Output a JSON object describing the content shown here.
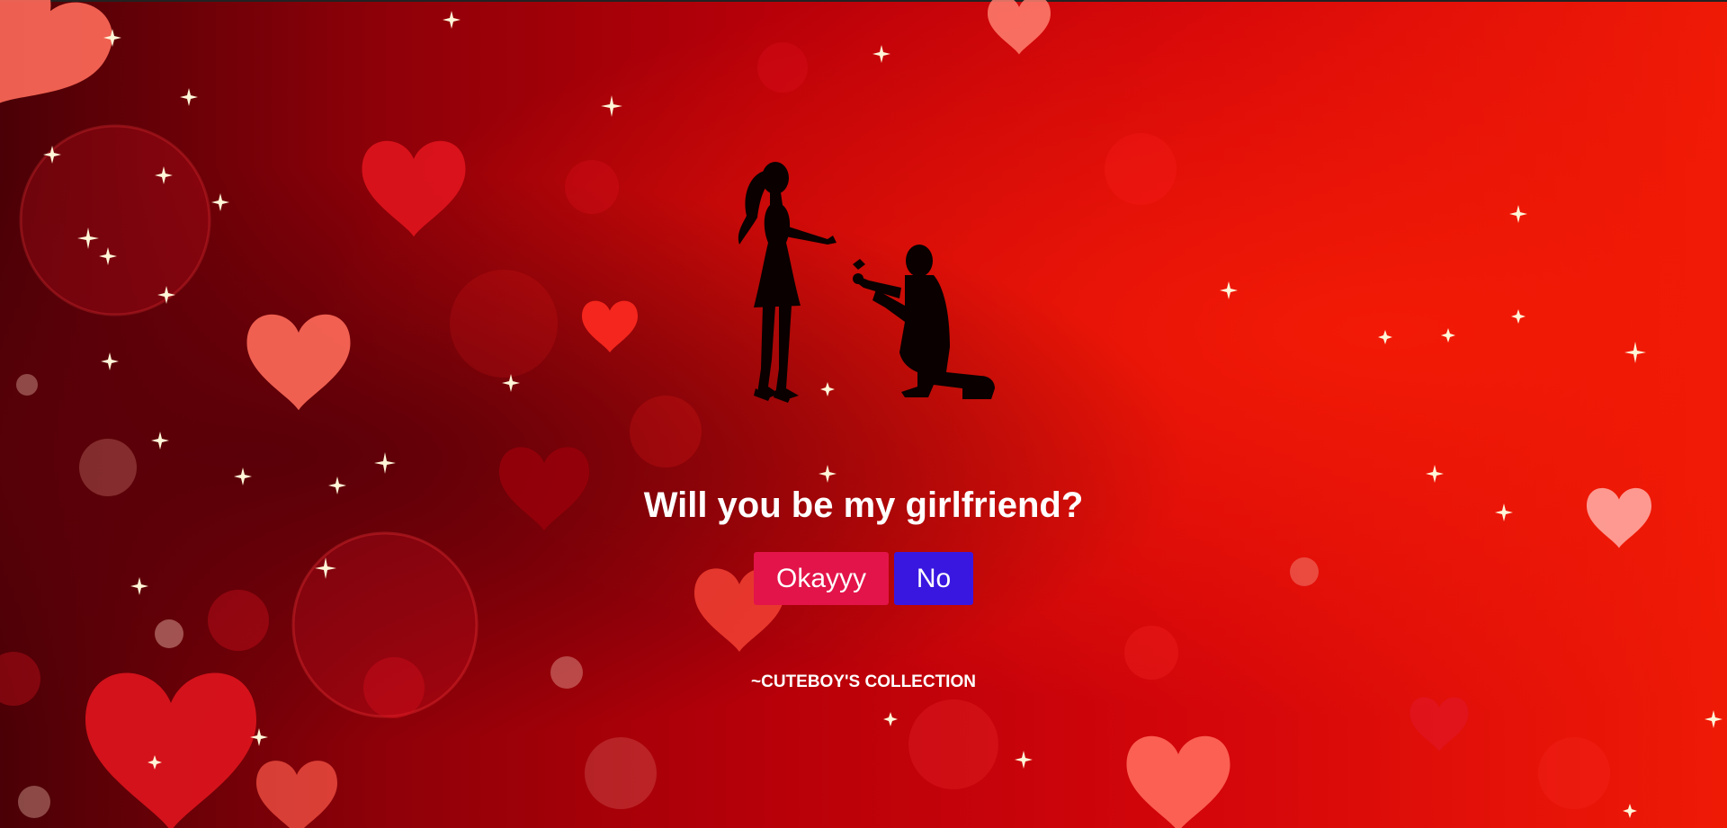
{
  "page": {
    "question": "Will you be my girlfriend?",
    "yes_button": "Okayyy",
    "no_button": "No",
    "credit": "~CUTEBOY'S COLLECTION"
  },
  "colors": {
    "yes_button": "#e3144a",
    "no_button": "#3a17e0",
    "text": "#ffffff",
    "background_dark": "#4a0006",
    "background_bright": "#ef1a06",
    "heart_light": "#ff6a5a",
    "heart_red": "#e0141e"
  },
  "icons": {
    "illustration": "couple-proposal-silhouette-icon",
    "decorations": [
      "heart-icon",
      "sparkle-icon",
      "bokeh-circle-icon"
    ]
  }
}
